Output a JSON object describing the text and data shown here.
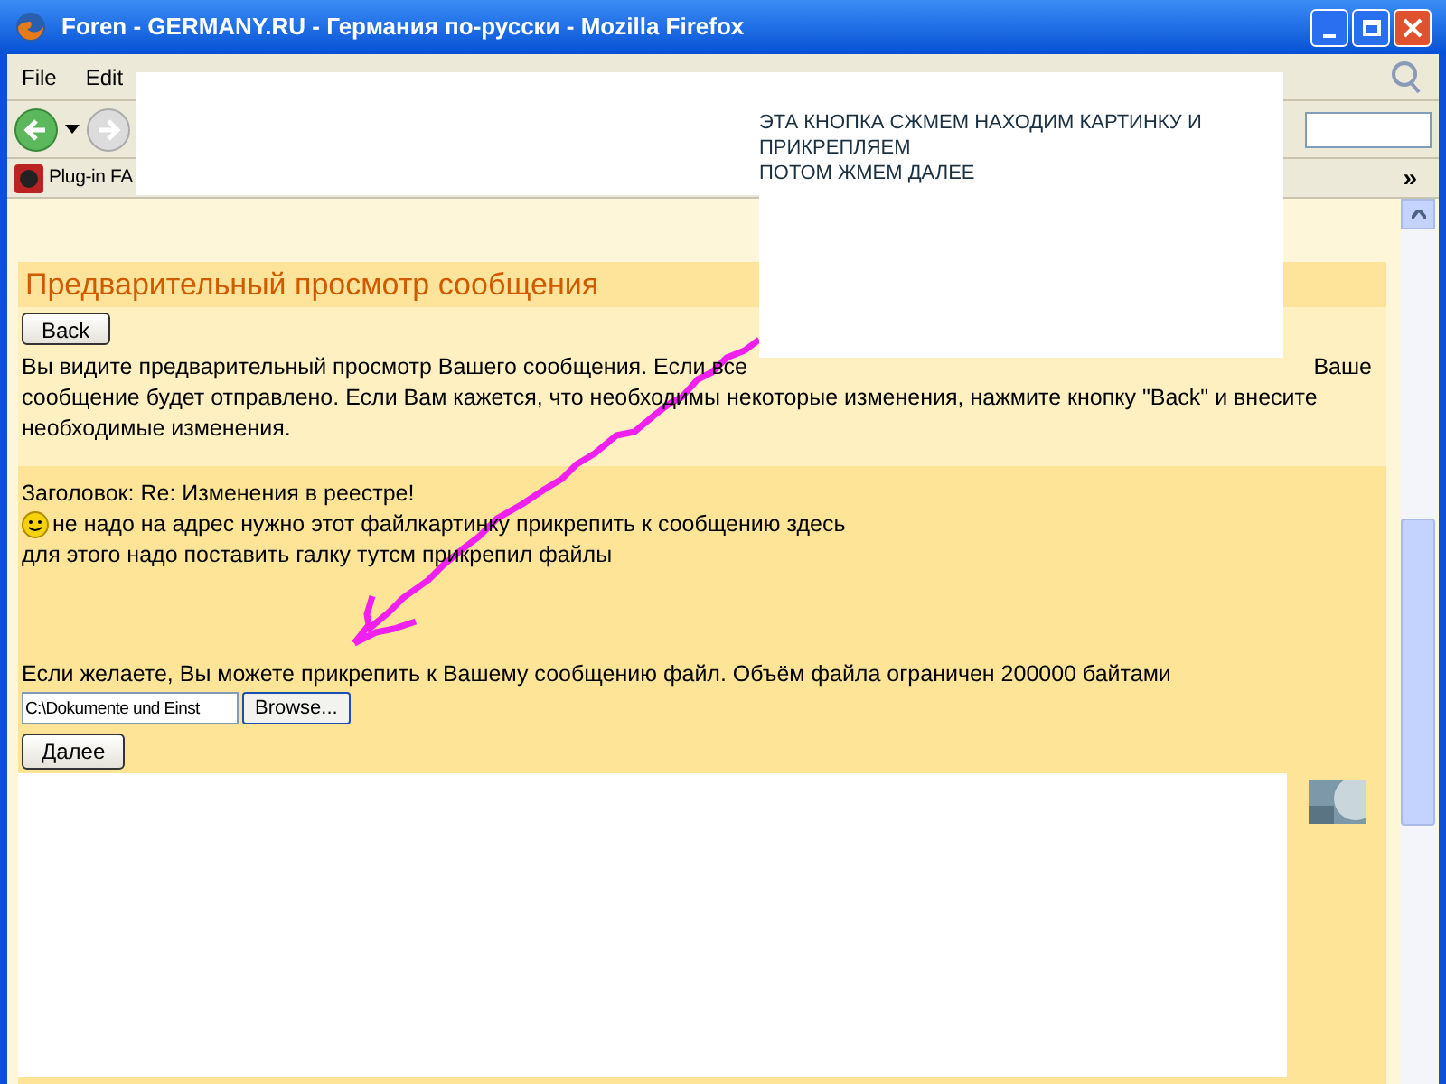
{
  "window": {
    "title": "Foren - GERMANY.RU - Германия по-русски - Mozilla Firefox"
  },
  "menu": [
    "File",
    "Edit"
  ],
  "bookmarks": {
    "items": [
      "Plug-in FA"
    ],
    "more": "»"
  },
  "note": {
    "lines": [
      "ЭТА КНОПКА СЖМЕМ НАХОДИМ КАРТИНКУ И ПРИКРЕПЛЯЕМ",
      "ПОТОМ ЖМЕМ ДАЛЕЕ"
    ]
  },
  "preview": {
    "heading": "Предварительный просмотр сообщения",
    "back_button": "Back",
    "intro_left": "Вы видите предварительный просмотр Вашего сообщения. Если все",
    "intro_right": "Ваше",
    "intro_rest": "сообщение будет отправлено. Если Вам кажется, что необходимы некоторые изменения, нажмите кнопку \"Back\" и внесите необходимые изменения.",
    "subject": "Заголовок: Re: Изменения в реестре!",
    "body": [
      "не надо на адрес нужно этот файлкартинку прикрепить к сообщению здесь",
      "для этого надо поставить галку тутсм прикрепил файлы"
    ],
    "attach_text": "Если желаете, Вы можете прикрепить к Вашему сообщению файл. Объём файла ограничен 200000 байтами",
    "file_value": "C:\\Dokumente und Einst",
    "browse_button": "Browse...",
    "next_button": "Далее"
  }
}
